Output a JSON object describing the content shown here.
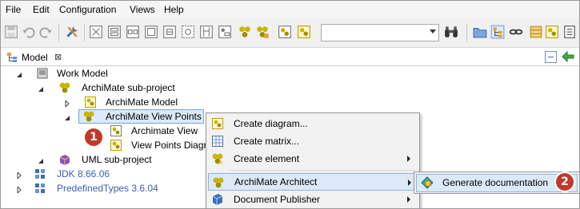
{
  "menubar": {
    "items": [
      "File",
      "Edit",
      "Configuration",
      "Views",
      "Help"
    ]
  },
  "toolbar": {
    "search_value": ""
  },
  "view": {
    "tab_label": "Model",
    "close_glyph": "⊠"
  },
  "tree": {
    "work_model": "Work Model",
    "archimate_subproject": "ArchiMate sub-project",
    "archimate_model": "ArchiMate Model",
    "archimate_viewpoints": "ArchiMate View Points",
    "archimate_view": "Archimate View",
    "viewpoints_diagram": "View Points Diagr",
    "uml_subproject": "UML sub-project",
    "jdk": "JDK 8.66.06",
    "predefined_types": "PredefinedTypes 3.6.04"
  },
  "context_menu": {
    "create_diagram": "Create diagram...",
    "create_matrix": "Create matrix...",
    "create_element": "Create element",
    "archimate_architect": "ArchiMate Architect",
    "document_publisher": "Document Publisher"
  },
  "submenu": {
    "generate_documentation": "Generate documentation"
  },
  "badges": {
    "one": "1",
    "two": "2"
  },
  "colors": {
    "selection": "#dbe9f8",
    "selection_border": "#7aa6d8",
    "badge": "#c0392b",
    "link_blue": "#3a5fb0"
  }
}
